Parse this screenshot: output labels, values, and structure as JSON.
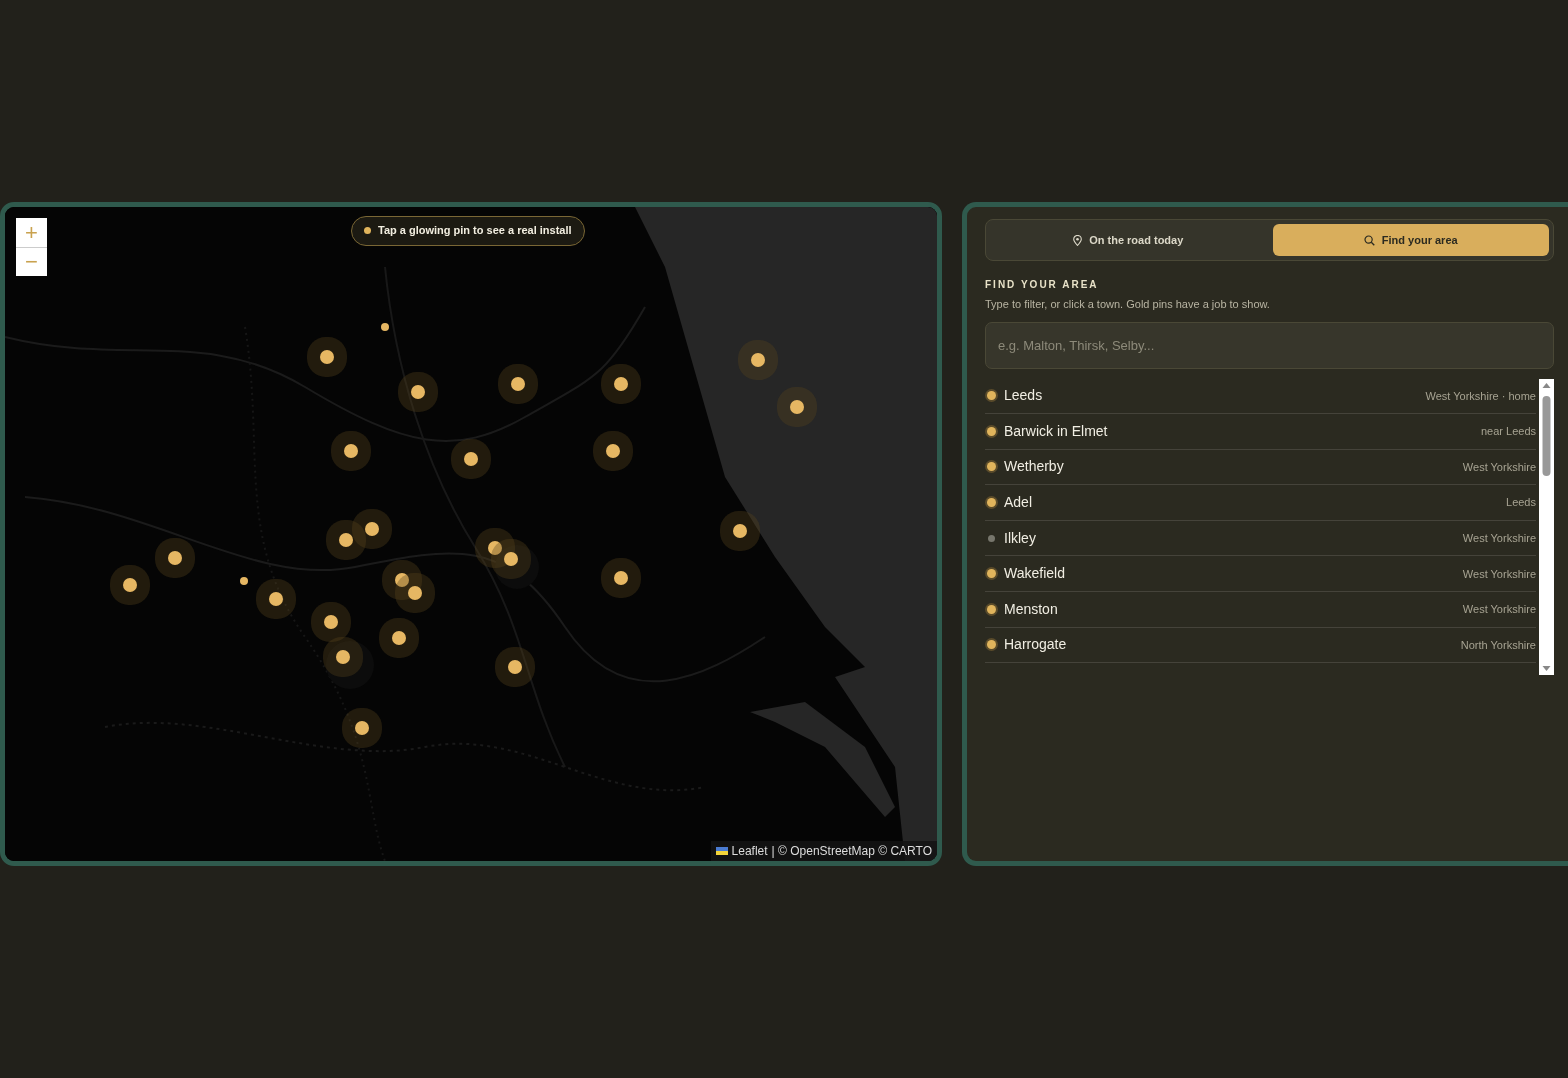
{
  "map": {
    "kind": "picture",
    "zoom_in": "+",
    "zoom_out": "−",
    "hint": "Tap a glowing pin to see a real install",
    "attribution": {
      "link": "Leaflet",
      "rest": "| © OpenStreetMap © CARTO"
    }
  },
  "panel": {
    "tabs": [
      {
        "label": "On the road today",
        "kind": "pin",
        "selected": false
      },
      {
        "label": "Find your area",
        "kind": "search",
        "selected": true
      }
    ],
    "heading": "FIND YOUR AREA",
    "subtitle": "Type to filter, or click a town. Gold pins have a job to show.",
    "search": {
      "placeholder": "e.g. Malton, Thirsk, Selby..."
    },
    "towns": [
      {
        "name": "Leeds",
        "region": "West Yorkshire · home",
        "has_job": true
      },
      {
        "name": "Barwick in Elmet",
        "region": "near Leeds",
        "has_job": true
      },
      {
        "name": "Wetherby",
        "region": "West Yorkshire",
        "has_job": true
      },
      {
        "name": "Adel",
        "region": "Leeds",
        "has_job": true
      },
      {
        "name": "Ilkley",
        "region": "West Yorkshire",
        "has_job": false
      },
      {
        "name": "Wakefield",
        "region": "West Yorkshire",
        "has_job": true
      },
      {
        "name": "Menston",
        "region": "West Yorkshire",
        "has_job": true
      },
      {
        "name": "Harrogate",
        "region": "North Yorkshire",
        "has_job": true
      }
    ]
  }
}
